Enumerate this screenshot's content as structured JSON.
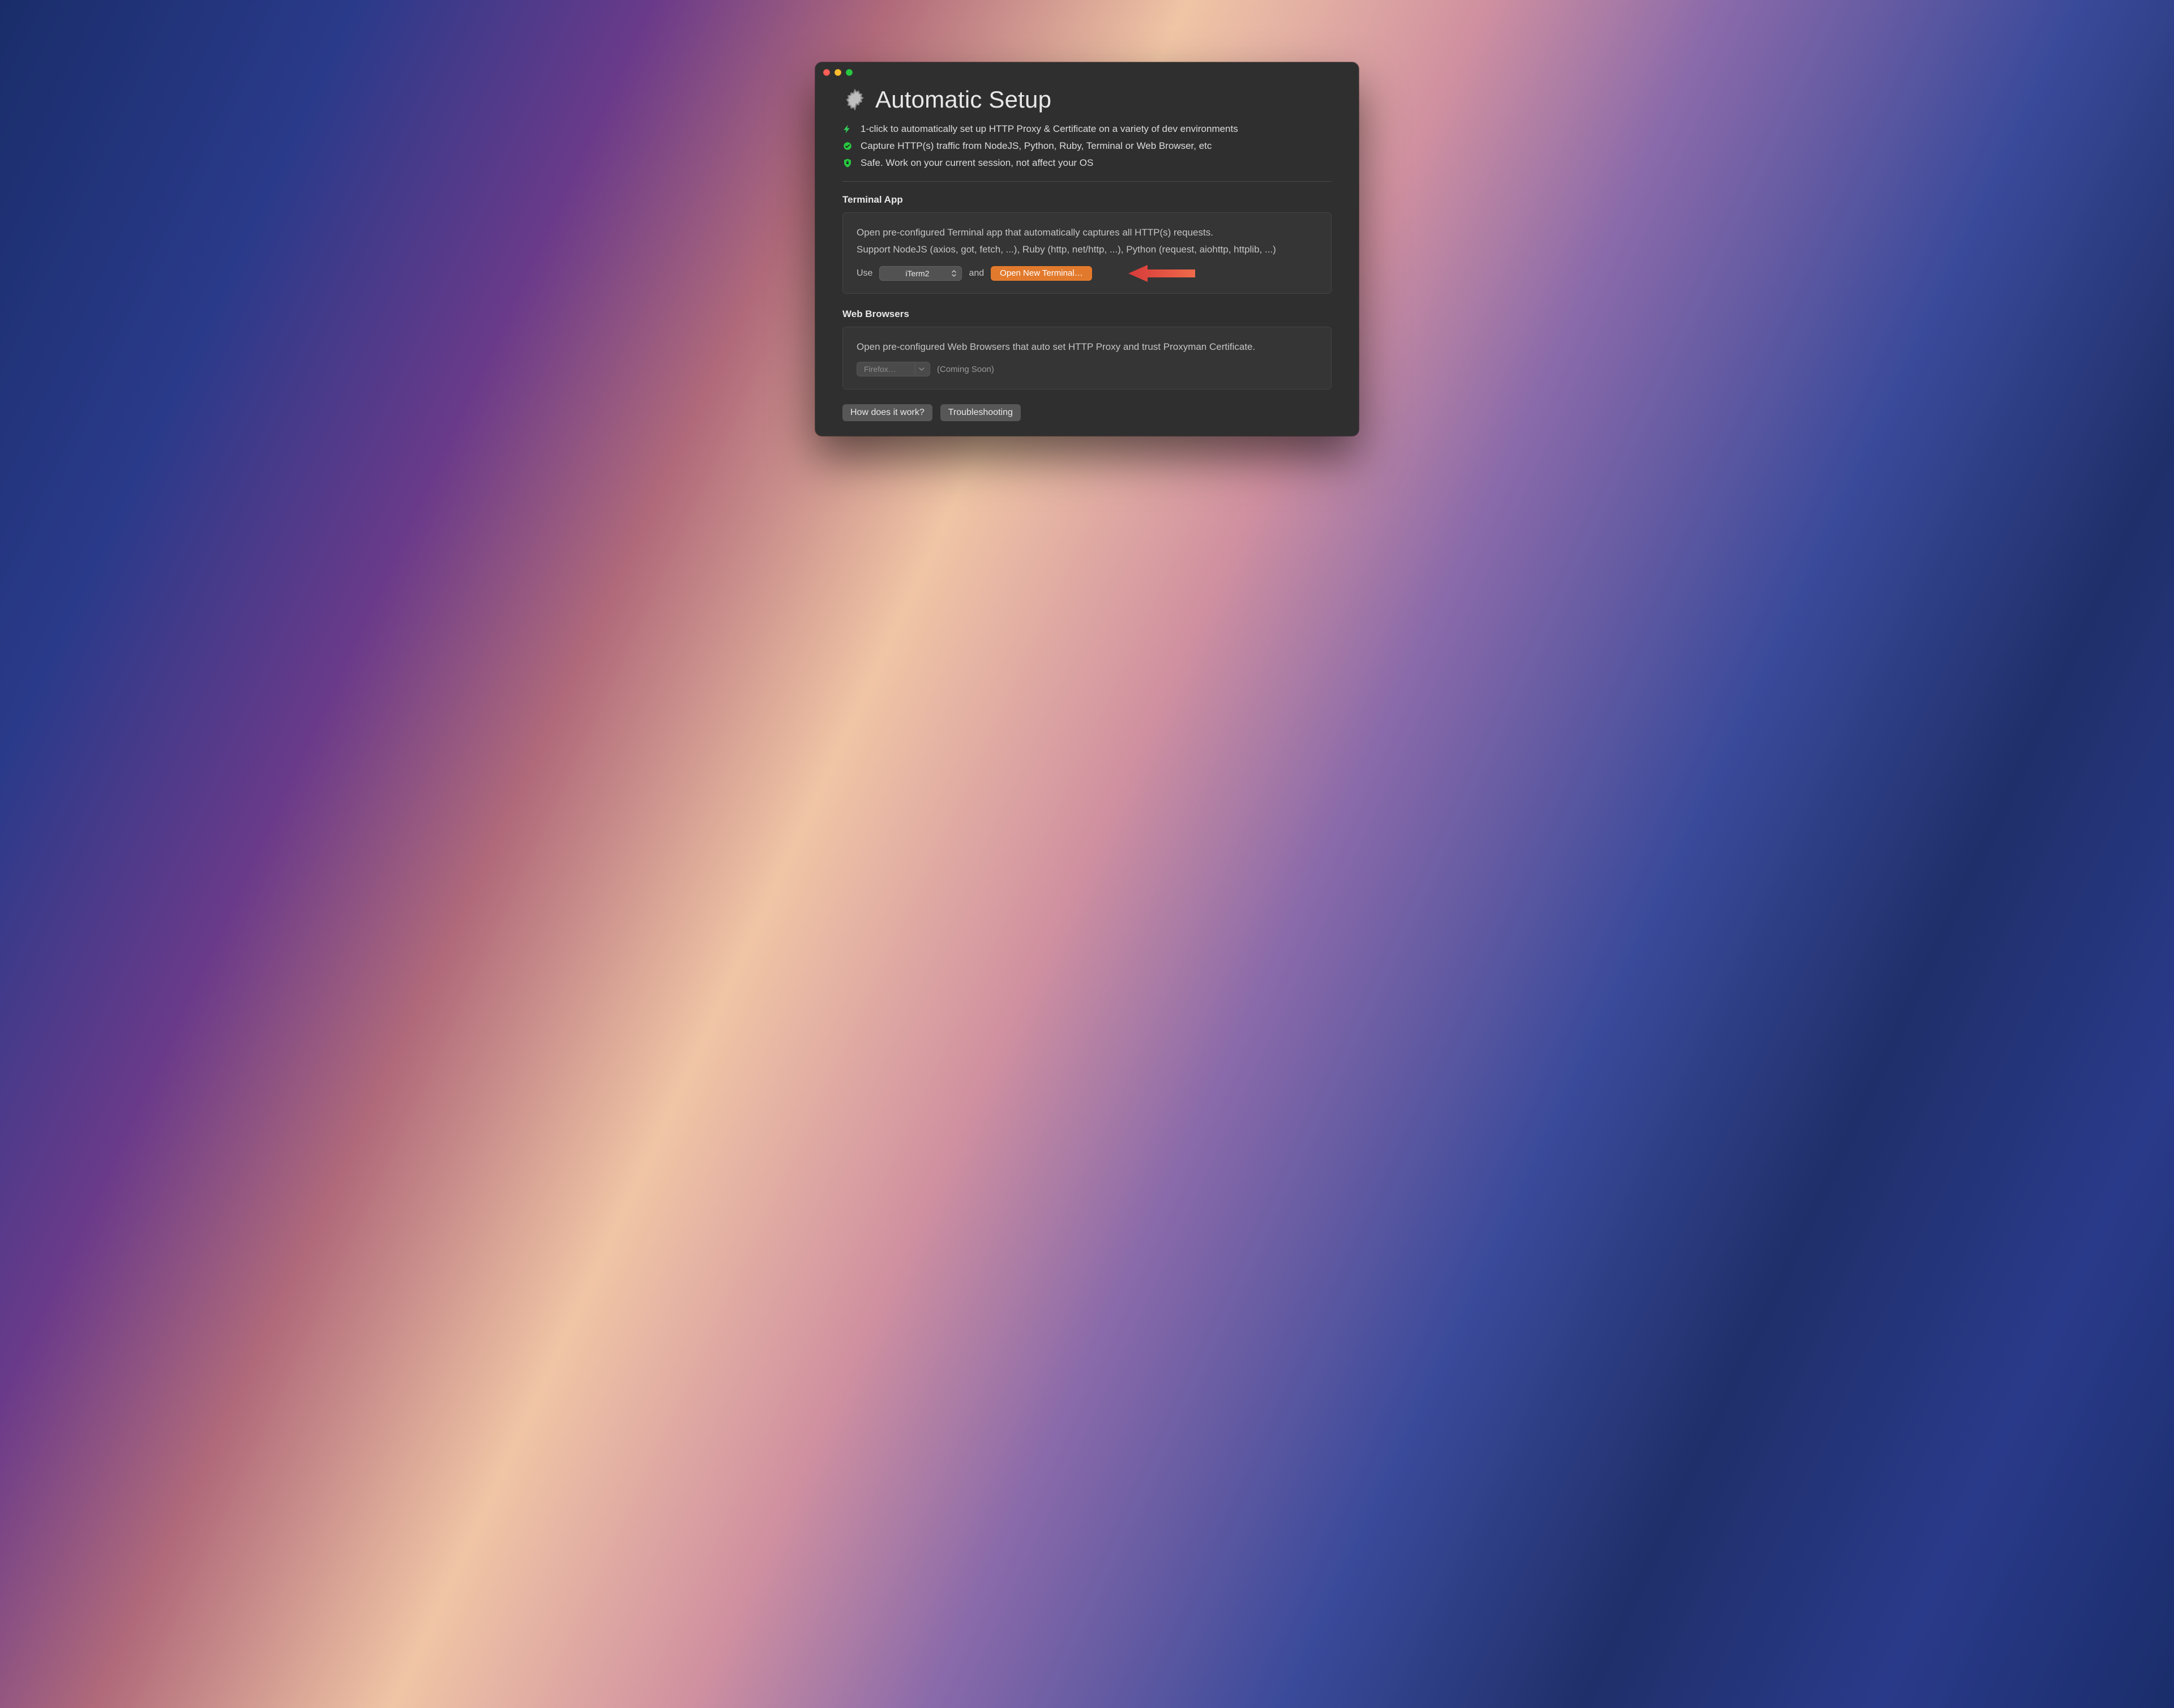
{
  "header": {
    "title": "Automatic Setup"
  },
  "features": [
    {
      "icon": "bolt",
      "text": "1-click to automatically set up HTTP Proxy & Certificate on a variety of dev environments"
    },
    {
      "icon": "check",
      "text": "Capture HTTP(s) traffic from NodeJS, Python, Ruby, Terminal or Web Browser, etc"
    },
    {
      "icon": "shield",
      "text": "Safe. Work on your current session, not affect your OS"
    }
  ],
  "terminal": {
    "heading": "Terminal App",
    "description_line1": "Open pre-configured Terminal app that automatically captures all HTTP(s) requests.",
    "description_line2": "Support NodeJS (axios, got, fetch, ...), Ruby (http, net/http, ...), Python (request, aiohttp, httplib, ...)",
    "use_label": "Use",
    "selected_app": "iTerm2",
    "and_label": "and",
    "open_button": "Open New Terminal…"
  },
  "browsers": {
    "heading": "Web Browsers",
    "description": "Open pre-configured Web Browsers that auto set HTTP Proxy and trust Proxyman Certificate.",
    "selected_app": "Firefox…",
    "coming_soon": "(Coming Soon)"
  },
  "footer": {
    "how_button": "How does it work?",
    "troubleshooting_button": "Troubleshooting"
  },
  "colors": {
    "accent": "#e27a2d",
    "green": "#28c840"
  }
}
